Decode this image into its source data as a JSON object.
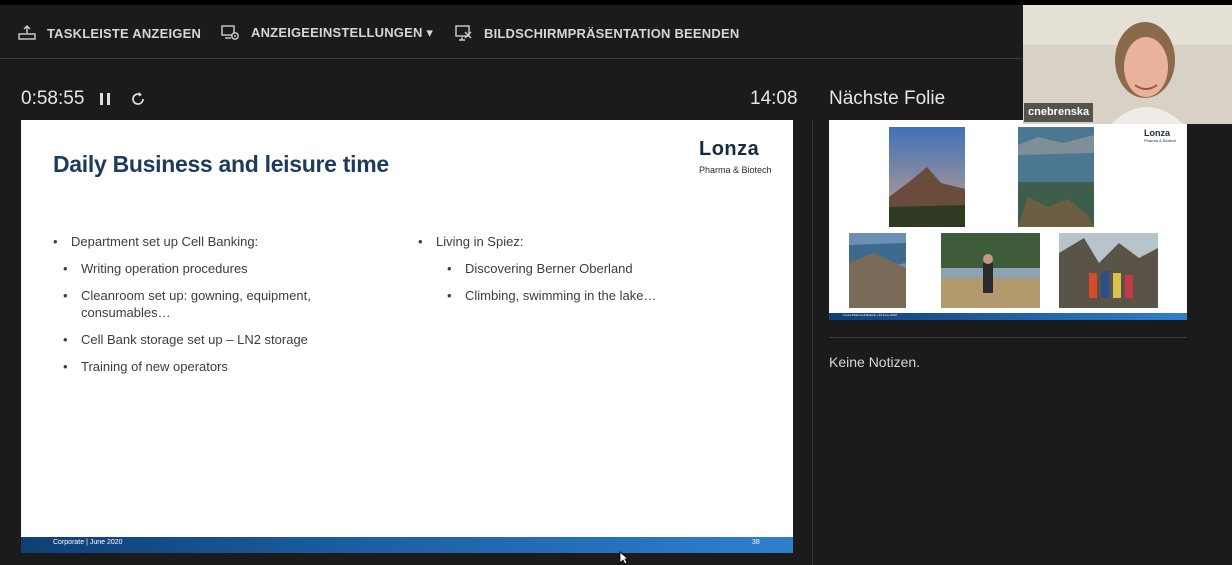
{
  "toolbar": {
    "taskbar_label": "TASKLEISTE ANZEIGEN",
    "display_settings_label": "ANZEIGEEINSTELLUNGEN ▾",
    "end_show_label": "BILDSCHIRMPRÄSENTATION BEENDEN"
  },
  "presenter": {
    "elapsed": "0:58:55",
    "clock": "14:08",
    "next_slide_label": "Nächste Folie",
    "notes": "Keine Notizen."
  },
  "slide": {
    "title": "Daily Business and leisure time",
    "logo_word": "Lonza",
    "logo_sub": "Pharma & Biotech",
    "left_heading": "Department set up Cell Banking:",
    "left_items": [
      "Writing operation procedures",
      "Cleanroom set up: gowning, equipment,",
      "consumables…",
      "Cell Bank storage set up – LN2 storage",
      "Training of new operators"
    ],
    "right_heading": "Living in Spiez:",
    "right_items": [
      "Discovering Berner Oberland",
      "Climbing, swimming in the lake…"
    ],
    "footer_left": "Corporate  |  June 2020",
    "page_number": "38"
  },
  "next_slide": {
    "logo_word": "Lonza",
    "logo_sub": "Pharma & Biotech",
    "footer": "Lonza Pharma & Biotech  |  23 June 2020"
  },
  "participant": {
    "name": "cnebrenska"
  },
  "colors": {
    "background": "#1b1b1b",
    "slide_title": "#1d3b5c",
    "footer_blue": "#1c5fa3"
  },
  "icons": [
    "taskbar-icon",
    "display-settings-icon",
    "end-slideshow-icon",
    "pause-icon",
    "restart-icon",
    "cursor-icon"
  ]
}
